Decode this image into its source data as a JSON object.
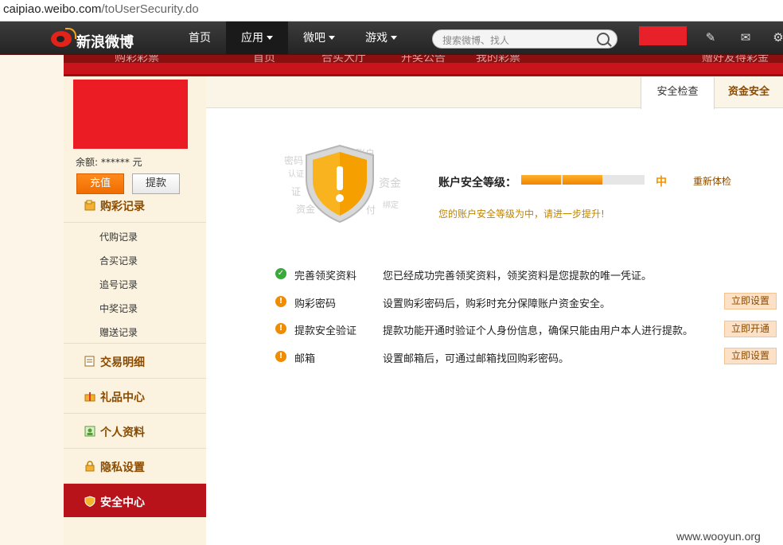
{
  "browser": {
    "url_host": "caipiao.weibo.com",
    "url_path": "/toUserSecurity.do"
  },
  "topnav": {
    "logo_text": "新浪微博",
    "items": [
      {
        "label": "首页",
        "dropdown": false,
        "active": false
      },
      {
        "label": "应用",
        "dropdown": true,
        "active": true
      },
      {
        "label": "微吧",
        "dropdown": true,
        "active": false
      },
      {
        "label": "游戏",
        "dropdown": true,
        "active": false
      }
    ],
    "search_placeholder": "搜索微博、找人",
    "icons": [
      "compose-icon",
      "message-icon",
      "settings-icon"
    ]
  },
  "subnav": {
    "items": [
      "购彩彩票",
      "首页",
      "合买大厅",
      "开奖公告",
      "我的彩票",
      "赠好友得彩金"
    ]
  },
  "sidebar": {
    "balance": "余额:   ****** 元",
    "recharge_label": "充值",
    "withdraw_label": "提款",
    "sections": [
      {
        "label": "购彩记录",
        "icon": "lottery-record-icon"
      },
      {
        "label": "交易明细",
        "icon": "transaction-icon"
      },
      {
        "label": "礼品中心",
        "icon": "gift-icon"
      },
      {
        "label": "个人资料",
        "icon": "profile-icon"
      },
      {
        "label": "隐私设置",
        "icon": "lock-icon"
      },
      {
        "label": "安全中心",
        "icon": "shield-icon"
      }
    ],
    "sub_items": [
      "代购记录",
      "合买记录",
      "追号记录",
      "中奖记录",
      "赠送记录"
    ]
  },
  "tabs": [
    {
      "label": "安全检查",
      "active": true
    },
    {
      "label": "资金安全",
      "active": false
    }
  ],
  "shield_words": [
    "密码",
    "账户",
    "资金",
    "证",
    "资金",
    "付",
    "绑定",
    "认证"
  ],
  "security": {
    "level_label": "账户安全等级：",
    "level_value": "中",
    "level_fraction": 0.66,
    "recheck_label": "重新体检",
    "hint": "您的账户安全等级为中，请进一步提升!"
  },
  "items": [
    {
      "status": "ok",
      "icon": "check-icon",
      "name": "完善领奖资料",
      "desc": "您已经成功完善领奖资料，领奖资料是您提款的唯一凭证。",
      "action": ""
    },
    {
      "status": "warn",
      "icon": "warning-icon",
      "name": "购彩密码",
      "desc": "设置购彩密码后，购彩时充分保障账户资金安全。",
      "action": "立即设置"
    },
    {
      "status": "warn",
      "icon": "warning-icon",
      "name": "提款安全验证",
      "desc": "提款功能开通时验证个人身份信息，确保只能由用户本人进行提款。",
      "action": "立即开通"
    },
    {
      "status": "warn",
      "icon": "warning-icon",
      "name": "邮箱",
      "desc": "设置邮箱后，可通过邮箱找回购彩密码。",
      "action": "立即设置"
    }
  ],
  "watermark": "www.wooyun.org",
  "colors": {
    "brand_red": "#b8121b",
    "accent_orange": "#f08400",
    "ok_green": "#3aa83a"
  }
}
